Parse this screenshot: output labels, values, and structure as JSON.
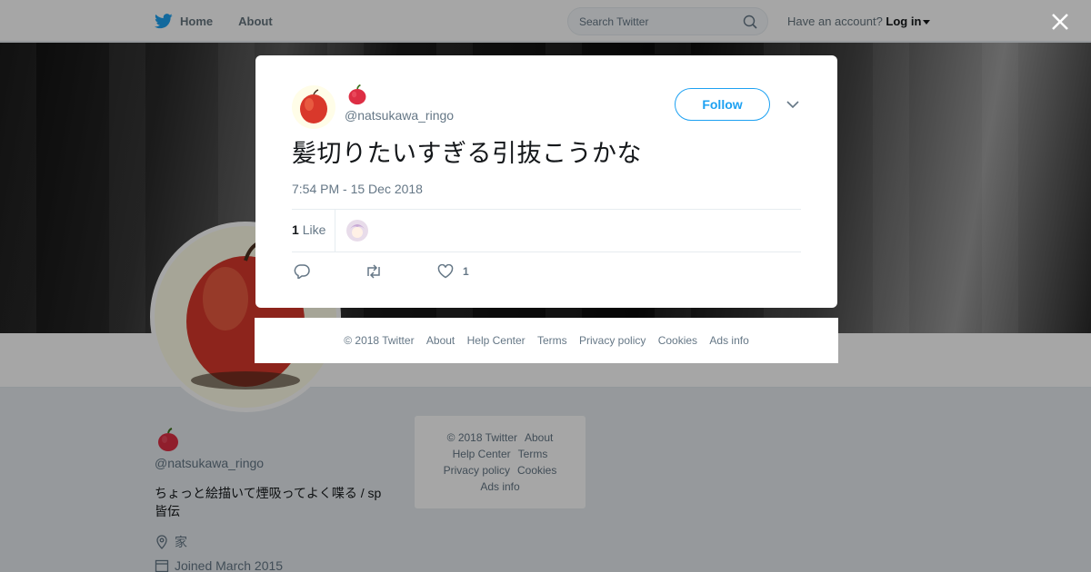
{
  "topbar": {
    "home_label": "Home",
    "about_label": "About",
    "search_placeholder": "Search Twitter",
    "account_prompt": "Have an account?",
    "login_label": "Log in"
  },
  "profile": {
    "name_emoji": "🍎",
    "handle": "@natsukawa_ringo",
    "bio": "ちょっと絵描いて煙吸ってよく喋る / sp 皆伝",
    "location": "家",
    "joined": "Joined March 2015"
  },
  "side_footer": {
    "copyright": "© 2018 Twitter",
    "about": "About",
    "help": "Help Center",
    "terms": "Terms",
    "privacy": "Privacy policy",
    "cookies": "Cookies",
    "ads": "Ads info"
  },
  "tweet": {
    "author_emoji": "🍎",
    "handle": "@natsukawa_ringo",
    "follow_label": "Follow",
    "text": "髪切りたいすぎる引抜こうかな",
    "timestamp": "7:54 PM - 15 Dec 2018",
    "likes_count": "1",
    "likes_label": "Like",
    "like_action_count": "1"
  },
  "modal_footer": {
    "copyright": "© 2018 Twitter",
    "about": "About",
    "help": "Help Center",
    "terms": "Terms",
    "privacy": "Privacy policy",
    "cookies": "Cookies",
    "ads": "Ads info"
  },
  "colors": {
    "accent": "#1da1f2",
    "secondary_text": "#657786",
    "overlay": "rgba(0,0,0,0.35)"
  },
  "icons": [
    "twitter-bird-icon",
    "search-icon",
    "close-icon",
    "chevron-down-icon",
    "reply-icon",
    "retweet-icon",
    "heart-icon",
    "location-icon",
    "calendar-icon"
  ]
}
